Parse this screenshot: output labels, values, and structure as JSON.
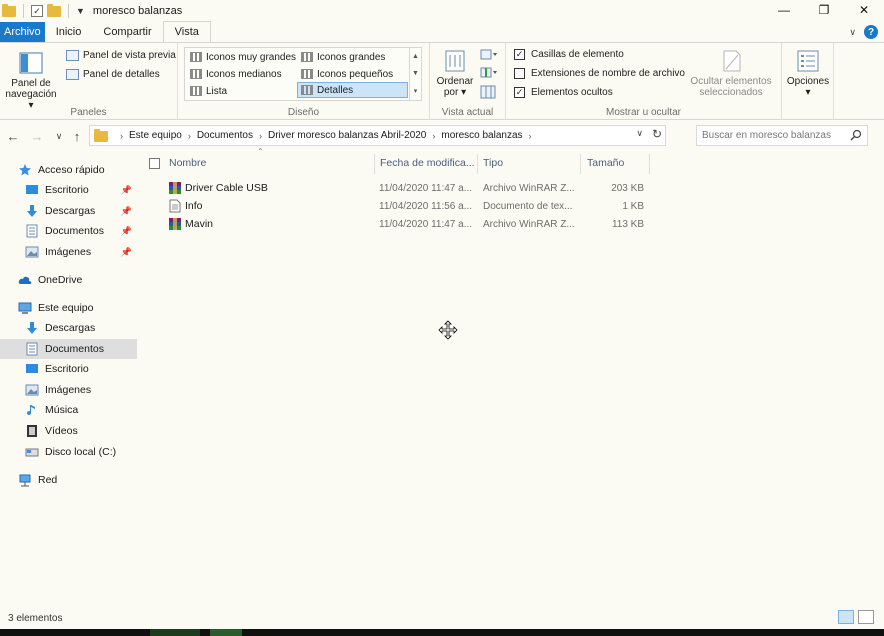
{
  "window": {
    "title": "moresco balanzas",
    "controls": [
      "—",
      "❐",
      "✕"
    ]
  },
  "ribbon_tabs": [
    {
      "label": "Archivo"
    },
    {
      "label": "Inicio"
    },
    {
      "label": "Compartir"
    },
    {
      "label": "Vista"
    }
  ],
  "ribbon": {
    "paneles": {
      "group_label": "Paneles",
      "nav_pane_line1": "Panel de",
      "nav_pane_line2": "navegación ▾",
      "preview_pane": "Panel de vista previa",
      "details_pane": "Panel de detalles"
    },
    "diseno": {
      "group_label": "Diseño",
      "items": [
        "Iconos muy grandes",
        "Iconos grandes",
        "Iconos medianos",
        "Iconos pequeños",
        "Lista",
        "Detalles"
      ],
      "selected": "Detalles"
    },
    "vista_actual": {
      "group_label": "Vista actual",
      "sort_line1": "Ordenar",
      "sort_line2": "por ▾"
    },
    "mostrar": {
      "group_label": "Mostrar u ocultar",
      "checkbox_items": [
        {
          "label": "Casillas de elemento",
          "checked": true
        },
        {
          "label": "Extensiones de nombre de archivo",
          "checked": false
        },
        {
          "label": "Elementos ocultos",
          "checked": true
        }
      ],
      "hide_selected_line1": "Ocultar elementos",
      "hide_selected_line2": "seleccionados"
    },
    "opciones": {
      "label": "Opciones",
      "arrow": "▾"
    }
  },
  "address": {
    "breadcrumbs": [
      "Este equipo",
      "Documentos",
      "Driver moresco balanzas Abril-2020",
      "moresco balanzas"
    ],
    "search_placeholder": "Buscar en moresco balanzas"
  },
  "nav_pane": {
    "quick_access": "Acceso rápido",
    "quick_items": [
      "Escritorio",
      "Descargas",
      "Documentos",
      "Imágenes"
    ],
    "onedrive": "OneDrive",
    "this_pc": "Este equipo",
    "pc_items": [
      "Descargas",
      "Documentos",
      "Escritorio",
      "Imágenes",
      "Música",
      "Vídeos",
      "Disco local (C:)"
    ],
    "selected": "Documentos",
    "network": "Red"
  },
  "file_list": {
    "columns": [
      "Nombre",
      "Fecha de modifica...",
      "Tipo",
      "Tamaño"
    ],
    "rows": [
      {
        "name": "Driver Cable USB",
        "date": "11/04/2020 11:47 a...",
        "type": "Archivo WinRAR Z...",
        "size": "203 KB",
        "icon": "winrar-icon"
      },
      {
        "name": "Info",
        "date": "11/04/2020 11:56 a...",
        "type": "Documento de tex...",
        "size": "1 KB",
        "icon": "text-file-icon"
      },
      {
        "name": "Mavin",
        "date": "11/04/2020 11:47 a...",
        "type": "Archivo WinRAR Z...",
        "size": "113 KB",
        "icon": "winrar-icon"
      }
    ]
  },
  "status": {
    "count": "3 elementos"
  },
  "colors": {
    "accent": "#1979ca",
    "background": "#fbfbf3",
    "selected_nav": "#dedede",
    "folder": "#e8b93f"
  }
}
